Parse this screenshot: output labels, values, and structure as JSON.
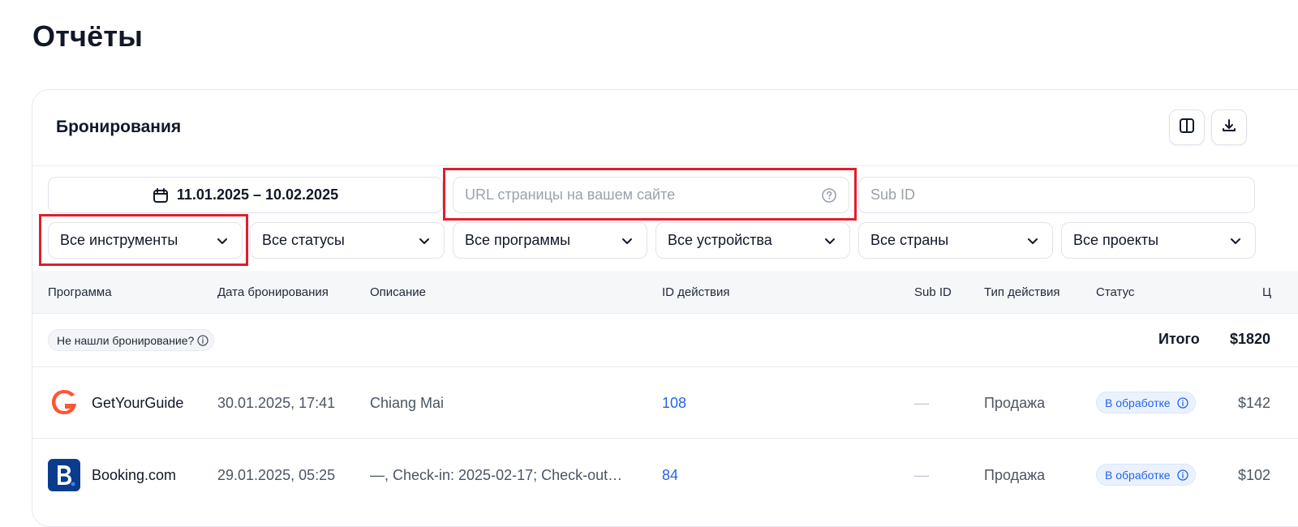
{
  "page": {
    "title": "Отчёты"
  },
  "card": {
    "title": "Бронирования"
  },
  "filters": {
    "date_range": "11.01.2025 – 10.02.2025",
    "url_placeholder": "URL страницы на вашем сайте",
    "subid_placeholder": "Sub ID",
    "selects": {
      "tools": "Все инструменты",
      "statuses": "Все статусы",
      "programs": "Все программы",
      "devices": "Все устройства",
      "countries": "Все страны",
      "projects": "Все проекты"
    }
  },
  "table": {
    "columns": [
      "Программа",
      "Дата бронирования",
      "Описание",
      "ID действия",
      "Sub ID",
      "Тип действия",
      "Статус",
      "Ц"
    ],
    "summary": {
      "not_found": "Не нашли бронирование?",
      "total_label": "Итого",
      "total_value": "$1820"
    },
    "rows": [
      {
        "program": "GetYourGuide",
        "date": "30.01.2025, 17:41",
        "description": "Chiang Mai",
        "action_id": "108",
        "sub_id": "—",
        "action_type": "Продажа",
        "status": "В обработке",
        "price": "$142"
      },
      {
        "program": "Booking.com",
        "date": "29.01.2025, 05:25",
        "description": "—, Check-in: 2025-02-17; Check-out…",
        "action_id": "84",
        "sub_id": "—",
        "action_type": "Продажа",
        "status": "В обработке",
        "price": "$102"
      }
    ]
  },
  "icons": {
    "calendar": "calendar-icon",
    "question": "question-circle-icon",
    "chevron": "chevron-down-icon",
    "columns": "columns-icon",
    "download": "download-icon",
    "info": "info-icon"
  },
  "colors": {
    "accent": "#2563eb",
    "annotation": "#e11d2e",
    "getyourguide": "#ff5533",
    "booking": "#0b3b8c"
  }
}
